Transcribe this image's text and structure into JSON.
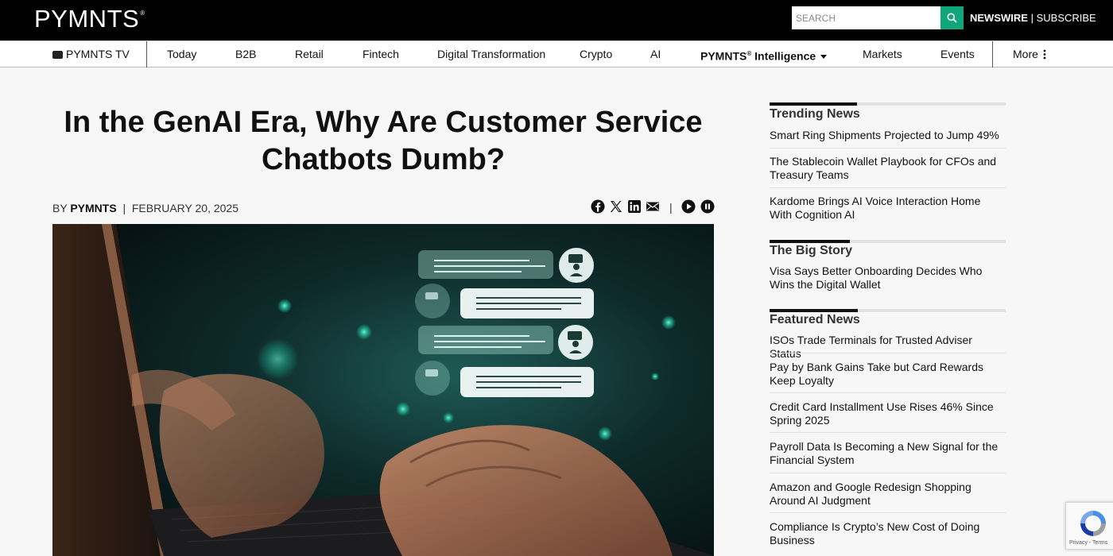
{
  "header": {
    "logo": "PYMNTS",
    "search_placeholder": "SEARCH",
    "newswire": "NEWSWIRE",
    "divider": "|",
    "subscribe": "SUBSCRIBE"
  },
  "nav": {
    "tv": "PYMNTS TV",
    "items": [
      "Today",
      "B2B",
      "Retail",
      "Fintech",
      "Digital Transformation",
      "Crypto",
      "AI"
    ],
    "intelligence": "PYMNTS",
    "intelligence_sup": "®",
    "intelligence_suffix": "Intelligence",
    "markets": "Markets",
    "events": "Events",
    "more": "More"
  },
  "article": {
    "title_line1": "In the GenAI Era, Why Are Customer Service",
    "title_line2": "Chatbots Dumb?",
    "by": "BY",
    "author": "PYMNTS",
    "pipe": "|",
    "date": "FEBRUARY 20, 2025",
    "share_sep": "|",
    "share_icons": [
      "facebook-icon",
      "x-icon",
      "linkedin-icon",
      "email-icon"
    ],
    "audio_icons": [
      "play-icon",
      "pause-icon"
    ]
  },
  "sidebar": {
    "trending": {
      "heading": "Trending News",
      "items": [
        "Smart Ring Shipments Projected to Jump 49%",
        "The Stablecoin Wallet Playbook for CFOs and Treasury Teams",
        "Kardome Brings AI Voice Interaction Home With Cognition AI"
      ]
    },
    "big_story": {
      "heading": "The Big Story",
      "items": [
        "Visa Says Better Onboarding Decides Who Wins the Digital Wallet"
      ]
    },
    "featured": {
      "heading": "Featured News",
      "items": [
        "ISOs Trade Terminals for Trusted Adviser Status",
        "Pay by Bank Gains Take but Card Rewards Keep Loyalty",
        "Credit Card Installment Use Rises 46% Since Spring 2025",
        "Payroll Data Is Becoming a New Signal for the Financial System",
        "Amazon and Google Redesign Shopping Around AI Judgment",
        "Compliance Is Crypto’s New Cost of Doing Business"
      ]
    }
  },
  "recaptcha": {
    "text": "Privacy - Terms"
  },
  "colors": {
    "accent": "#10a57a",
    "header_bg": "#000000"
  }
}
